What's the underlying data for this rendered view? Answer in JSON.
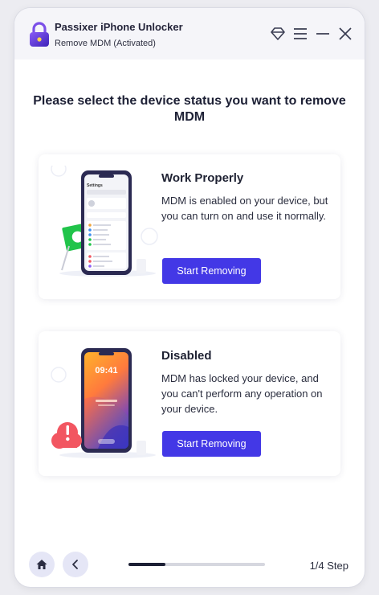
{
  "titlebar": {
    "app_name": "Passixer iPhone Unlocker",
    "subtitle": "Remove MDM  (Activated)",
    "icons": [
      "lock-logo-icon",
      "diamond-icon",
      "menu-icon",
      "minimize-icon",
      "close-icon"
    ]
  },
  "main": {
    "heading": "Please select the device status you want to remove MDM",
    "cards": [
      {
        "title": "Work Properly",
        "description": "MDM is enabled on your device, but you can turn on and use it normally.",
        "button": "Start Removing"
      },
      {
        "title": "Disabled",
        "description": "MDM has locked your device, and you can't perform any operation on your device.",
        "button": "Start Removing"
      }
    ]
  },
  "footer": {
    "progress": 0.27,
    "step": "1/4 Step"
  },
  "colors": {
    "accent": "#4338e6",
    "background": "#ffffff",
    "titlebar": "#f5f5f9",
    "green_flag": "#21c44a",
    "alert_red": "#f25661"
  }
}
